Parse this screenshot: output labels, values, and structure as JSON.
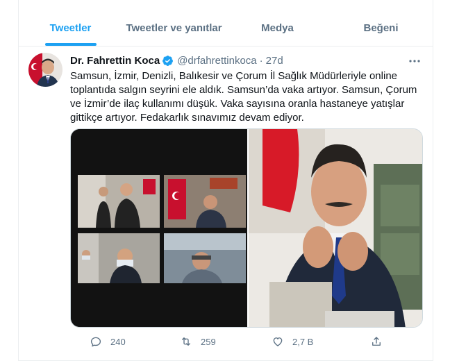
{
  "tabs": [
    {
      "label": "Tweetler",
      "active": true
    },
    {
      "label": "Tweetler ve yanıtlar",
      "active": false
    },
    {
      "label": "Medya",
      "active": false
    },
    {
      "label": "Beğeni",
      "active": false
    }
  ],
  "tweet": {
    "author_name": "Dr. Fahrettin Koca",
    "handle": "@drfahrettinkoca",
    "separator": "·",
    "time": "27d",
    "text": "Samsun, İzmir, Denizli, Balıkesir ve Çorum İl Sağlık Müdürleriyle online toplantıda salgın seyrini ele aldık. Samsun’da vaka artıyor. Samsun, Çorum ve İzmir’de ilaç kullanımı düşük. Vaka sayısına oranla hastaneye yatışlar gittikçe artıyor. Fedakarlık sınavımız devam ediyor.",
    "replies": "240",
    "retweets": "259",
    "likes": "2,7 B"
  },
  "colors": {
    "accent": "#1da1f2",
    "secondary_text": "#5b7083",
    "border": "#ebeef0"
  },
  "icons": {
    "verified": "verified-badge-icon",
    "more": "more-icon",
    "reply": "reply-icon",
    "retweet": "retweet-icon",
    "like": "heart-icon",
    "share": "share-icon"
  }
}
